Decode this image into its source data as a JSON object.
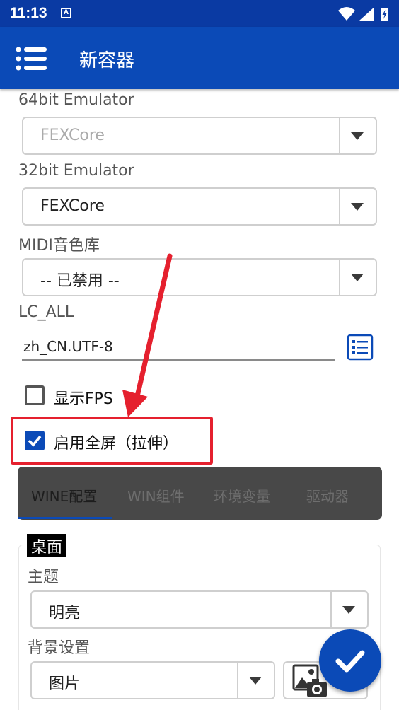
{
  "status_bar": {
    "time": "11:13",
    "notif_glyph": "A",
    "icons": [
      "wifi-icon",
      "signal-icon",
      "battery-icon"
    ]
  },
  "app_bar": {
    "title": "新容器",
    "menu_icon": "list-menu-icon"
  },
  "emulator64": {
    "label": "64bit Emulator",
    "value": "FEXCore",
    "disabled": true
  },
  "emulator32": {
    "label": "32bit Emulator",
    "value": "FEXCore"
  },
  "midi": {
    "label": "MIDI音色库",
    "value": "-- 已禁用 --"
  },
  "lc_all": {
    "label": "LC_ALL",
    "value": "zh_CN.UTF-8",
    "picker_icon": "list-icon"
  },
  "show_fps": {
    "label": "显示FPS",
    "checked": false
  },
  "fullscreen": {
    "label": "启用全屏（拉伸）",
    "checked": true
  },
  "tabs": [
    {
      "label": "WINE配置",
      "active": true
    },
    {
      "label": "WIN组件",
      "active": false
    },
    {
      "label": "环境变量",
      "active": false
    },
    {
      "label": "驱动器",
      "active": false
    }
  ],
  "desktop": {
    "title": "桌面",
    "theme_label": "主题",
    "theme_value": "明亮",
    "background_label": "背景设置",
    "background_value": "图片",
    "image_button_icon": "image-camera-icon"
  },
  "fab_icon": "check-icon",
  "colors": {
    "primary": "#0b4ab7",
    "status_bar": "#0a3aa3",
    "annotation": "#e5202e",
    "tab_bar": "#484848"
  }
}
